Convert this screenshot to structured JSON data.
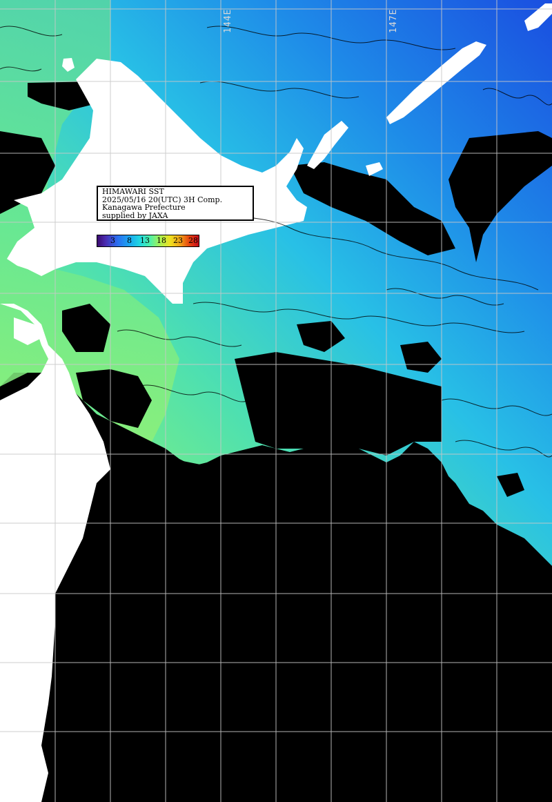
{
  "header": {
    "line1": "HIMAWARI SST",
    "line2": "2025/05/16 20(UTC) 3H Comp.",
    "line3": "Kanagawa Prefecture",
    "line4": "supplied by JAXA"
  },
  "legend": {
    "ticks": [
      "3",
      "8",
      "13",
      "18",
      "23",
      "28"
    ],
    "colors": [
      "#3a0a6e",
      "#2a6ef0",
      "#22d8e0",
      "#a8f050",
      "#f0a018",
      "#c80a1a"
    ]
  },
  "grid": {
    "lon_labels": [
      "144E",
      "147E"
    ]
  },
  "palette": {
    "land": "#ffffff",
    "no_data": "#000000",
    "cold_water": "#2070e8",
    "mid_water": "#22c8e8",
    "warm_water": "#7ef080",
    "grid_line": "#c8c8c8",
    "contour": "#000000"
  }
}
